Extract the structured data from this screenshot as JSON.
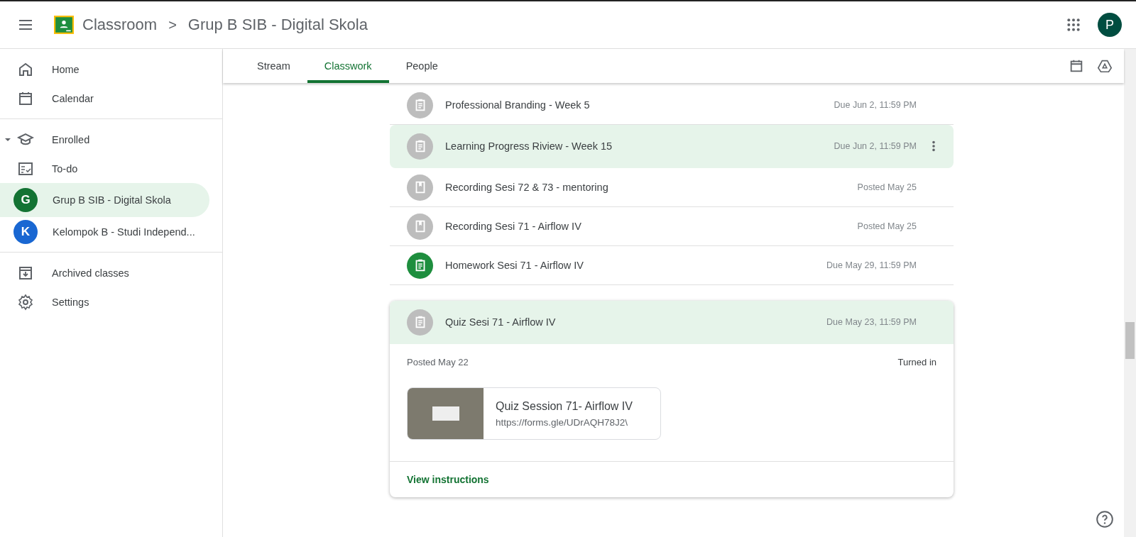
{
  "header": {
    "app_name": "Classroom",
    "breadcrumb_separator": ">",
    "class_name": "Grup B SIB - Digital Skola",
    "avatar_letter": "P"
  },
  "sidebar": {
    "top_items": [
      {
        "kind": "home",
        "label": "Home"
      },
      {
        "kind": "calendar",
        "label": "Calendar"
      }
    ],
    "enrolled": {
      "label": "Enrolled",
      "expanded": true,
      "items": [
        {
          "kind": "todo",
          "label": "To-do",
          "selected": false
        },
        {
          "kind": "class",
          "letter": "G",
          "color": "#137333",
          "label": "Grup B SIB - Digital Skola",
          "selected": true
        },
        {
          "kind": "class",
          "letter": "K",
          "color": "#1967d2",
          "label": "Kelompok B - Studi Independ...",
          "selected": false
        }
      ]
    },
    "bottom_items": [
      {
        "kind": "archive",
        "label": "Archived classes"
      },
      {
        "kind": "settings",
        "label": "Settings"
      }
    ]
  },
  "tabs": [
    {
      "label": "Stream",
      "selected": false
    },
    {
      "label": "Classwork",
      "selected": true
    },
    {
      "label": "People",
      "selected": false
    }
  ],
  "items": [
    {
      "kind": "assignment",
      "color": "#bdbdbd",
      "title": "Professional Branding - Week 5",
      "date": "Due Jun 2, 11:59 PM",
      "selected": false,
      "expanded": false
    },
    {
      "kind": "assignment",
      "color": "#bdbdbd",
      "title": "Learning Progress Riview - Week 15",
      "date": "Due Jun 2, 11:59 PM",
      "selected": true,
      "expanded": false
    },
    {
      "kind": "material",
      "color": "#bdbdbd",
      "title": "Recording Sesi 72 & 73 - mentoring",
      "date": "Posted May 25",
      "selected": false,
      "expanded": false
    },
    {
      "kind": "material",
      "color": "#bdbdbd",
      "title": "Recording Sesi 71 - Airflow IV",
      "date": "Posted May 25",
      "selected": false,
      "expanded": false
    },
    {
      "kind": "assignment",
      "color": "#1e8e3e",
      "title": "Homework Sesi 71 - Airflow IV",
      "date": "Due May 29, 11:59 PM",
      "selected": false,
      "expanded": false
    },
    {
      "kind": "assignment",
      "color": "#bdbdbd",
      "title": "Quiz Sesi 71 - Airflow IV",
      "date": "Due May 23, 11:59 PM",
      "selected": true,
      "expanded": true,
      "details": {
        "posted": "Posted May 22",
        "status": "Turned in",
        "attachment": {
          "title": "Quiz Session 71- Airflow IV",
          "url": "https://forms.gle/UDrAQH78J2\\"
        },
        "link": "View instructions"
      }
    }
  ]
}
